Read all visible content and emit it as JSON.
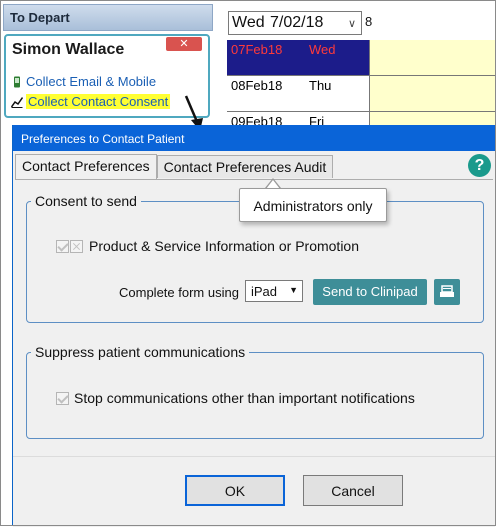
{
  "left_panel": {
    "header": "To Depart",
    "patient_name": "Simon Wallace",
    "tasks": [
      {
        "label": "Collect Email & Mobile",
        "icon": "mobile-phone-icon"
      },
      {
        "label": "Collect Contact Consent",
        "icon": "chart-trend-icon",
        "highlighted": true
      }
    ]
  },
  "calendar": {
    "day": "Wed",
    "date": "7/02/18",
    "extra": "8",
    "rows": [
      {
        "date": "07Feb18",
        "weekday": "Wed",
        "selected": true
      },
      {
        "date": "08Feb18",
        "weekday": "Thu"
      },
      {
        "date": "09Feb18",
        "weekday": "Fri"
      }
    ]
  },
  "dialog": {
    "title": "Preferences to Contact Patient",
    "tabs": [
      "Contact Preferences",
      "Contact Preferences Audit"
    ],
    "active_tab": 0,
    "help": "?",
    "tooltip": "Administrators only",
    "consent_group": {
      "legend": "Consent to send",
      "option_label": "Product & Service Information or Promotion",
      "complete_form_label": "Complete form using",
      "device_value": "iPad",
      "send_button": "Send to Clinipad"
    },
    "suppress_group": {
      "legend": "Suppress patient communications",
      "option_label": "Stop communications other than important notifications"
    },
    "ok_button": "OK",
    "cancel_button": "Cancel"
  },
  "colors": {
    "accent": "#0a64d8",
    "teal_button": "#3e8e98",
    "highlight": "#ffff33",
    "selected_row": "#1c1c8a"
  }
}
